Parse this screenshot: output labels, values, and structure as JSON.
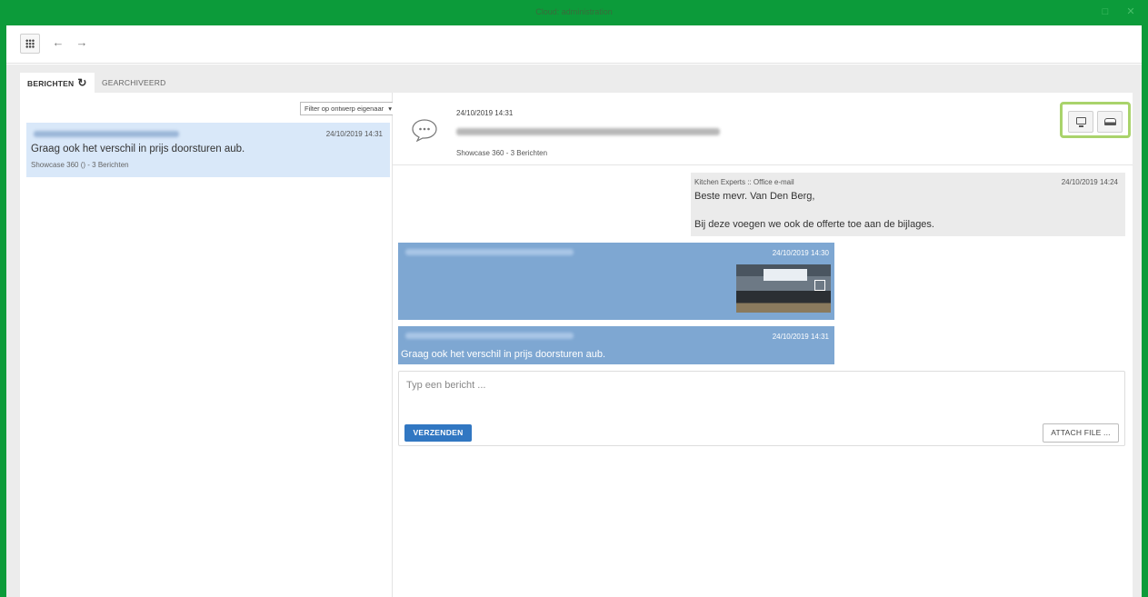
{
  "window": {
    "title": "Cloud: administration",
    "minimize": "□",
    "close": "✕"
  },
  "toolbar": {
    "back": "←",
    "forward": "→"
  },
  "tabs": [
    {
      "label": "BERICHTEN"
    },
    {
      "label": "GEARCHIVEERD"
    }
  ],
  "left": {
    "filter_label": "Filter op ontwerp eigenaar",
    "filter_caret": "▾",
    "conversations": [
      {
        "date": "24/10/2019 14:31",
        "message": "Graag ook het verschil in prijs doorsturen aub.",
        "subtitle": "Showcase 360 () - 3 Berichten"
      }
    ]
  },
  "right": {
    "header": {
      "date": "24/10/2019 14:31",
      "subtitle": "Showcase 360 - 3 Berichten"
    },
    "messages": [
      {
        "from": "Kitchen Experts :: Office e-mail",
        "date": "24/10/2019 14:24",
        "line1": "Beste mevr. Van Den Berg,",
        "line2": "Bij deze voegen we ook de offerte toe aan de bijlages."
      },
      {
        "date": "24/10/2019 14:30"
      },
      {
        "date": "24/10/2019 14:31",
        "message": "Graag ook het verschil in prijs doorsturen aub."
      }
    ],
    "compose": {
      "placeholder": "Typ een bericht ...",
      "send_label": "VERZENDEN",
      "attach_label": "ATTACH FILE ..."
    }
  },
  "colors": {
    "titlebar": "#0c9b3a",
    "bubble_blue": "#7ea7d2",
    "highlight": "#a9d36b",
    "send_button": "#3177c2"
  }
}
